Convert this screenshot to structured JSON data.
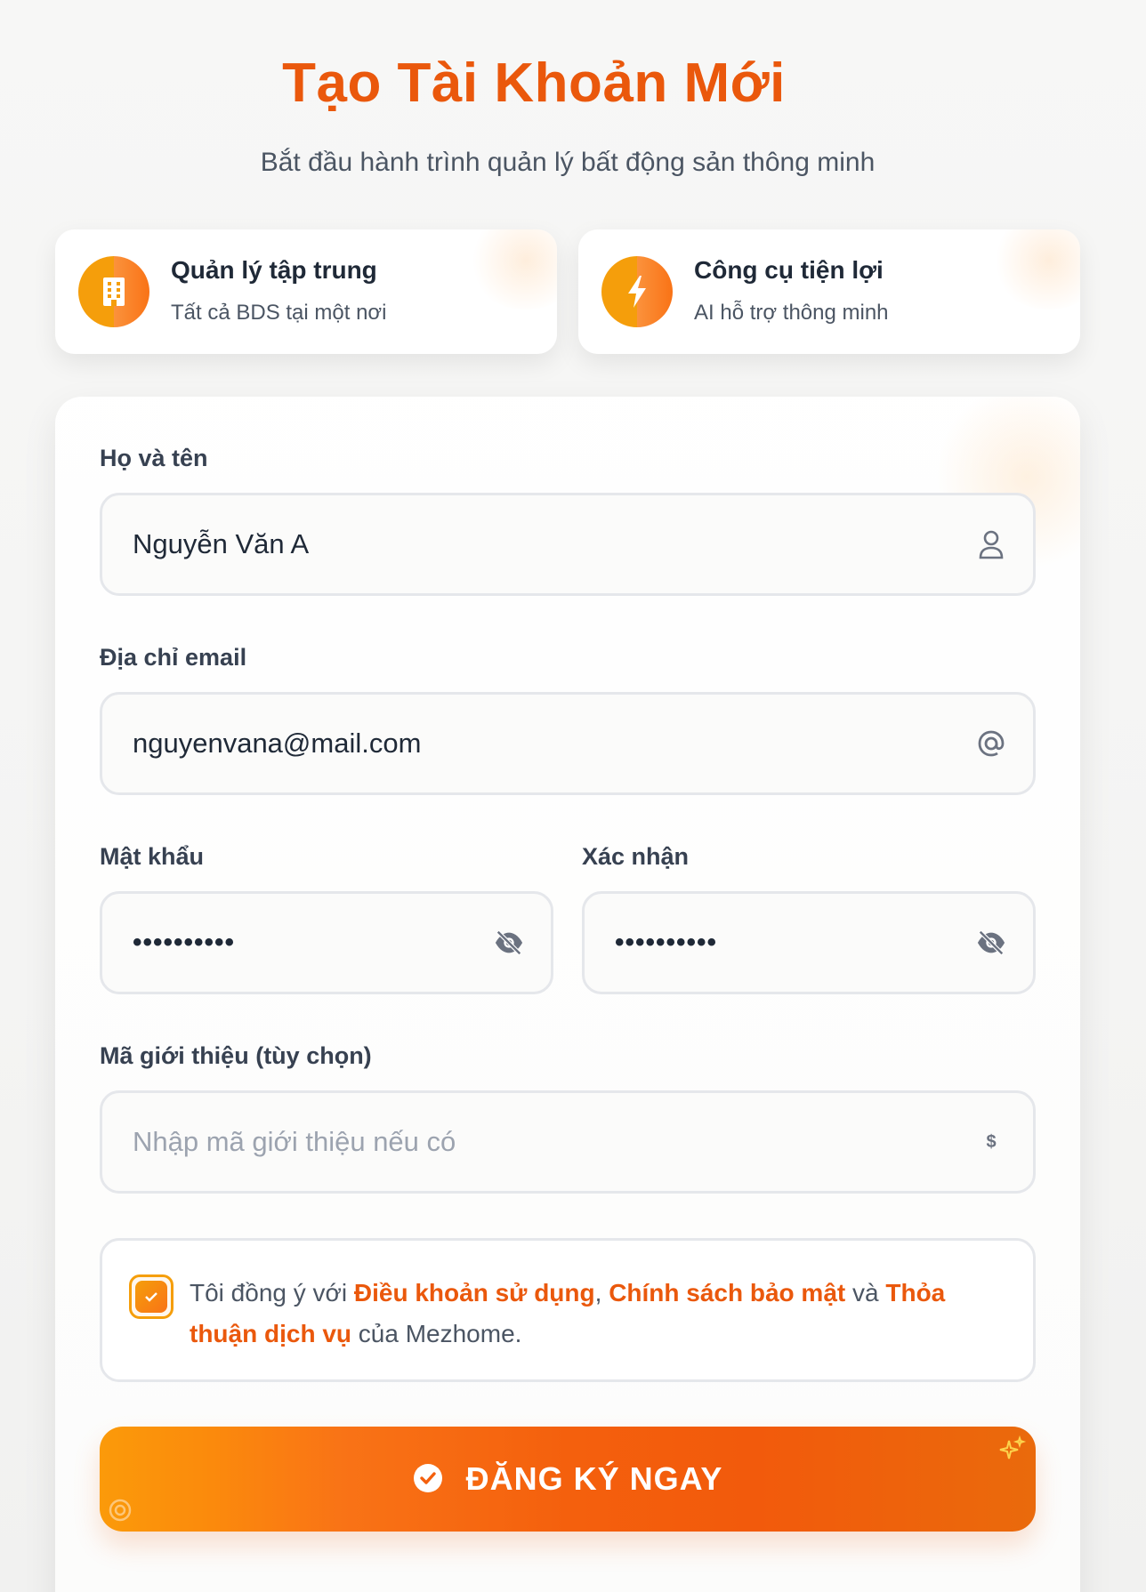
{
  "header": {
    "title": "Tạo Tài Khoản Mới",
    "subtitle": "Bắt đầu hành trình quản lý bất động sản thông minh"
  },
  "features": [
    {
      "icon": "building-icon",
      "title": "Quản lý tập trung",
      "description": "Tất cả BDS tại một nơi"
    },
    {
      "icon": "lightning-icon",
      "title": "Công cụ tiện lợi",
      "description": "AI hỗ trợ thông minh"
    }
  ],
  "form": {
    "name": {
      "label": "Họ và tên",
      "value": "Nguyễn Văn A",
      "icon": "user-icon"
    },
    "email": {
      "label": "Địa chỉ email",
      "value": "nguyenvana@mail.com",
      "icon": "at-icon"
    },
    "password": {
      "label": "Mật khẩu",
      "value": "••••••••••",
      "icon": "eye-off-icon"
    },
    "confirm": {
      "label": "Xác nhận",
      "value": "••••••••••",
      "icon": "eye-off-icon"
    },
    "referral": {
      "label": "Mã giới thiệu (tùy chọn)",
      "value": "",
      "placeholder": "Nhập mã giới thiệu nếu có",
      "icon": "dollar-icon",
      "icon_glyph": "$"
    }
  },
  "terms": {
    "checked": true,
    "prefix": "Tôi đồng ý với ",
    "link_terms": "Điều khoản sử dụng",
    "sep": ", ",
    "link_privacy": "Chính sách bảo mật",
    "and": " và ",
    "link_service": "Thỏa thuận dịch vụ",
    "suffix": " của Mezhome."
  },
  "submit": {
    "label": "ĐĂNG KÝ NGAY",
    "icon": "check-circle-icon"
  },
  "colors": {
    "accent": "#ea580c",
    "accent_light": "#f59e0b",
    "text": "#1f2937",
    "muted": "#4b5563",
    "border": "#e5e7eb"
  }
}
